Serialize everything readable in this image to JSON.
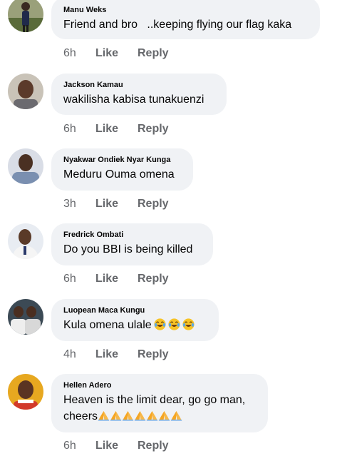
{
  "comments": [
    {
      "author": "Manu Weks",
      "text": "Friend and bro   ..keeping flying our flag kaka",
      "time": "6h",
      "like": "Like",
      "reply": "Reply"
    },
    {
      "author": "Jackson Kamau",
      "text": "wakilisha kabisa tunakuenzi",
      "time": "6h",
      "like": "Like",
      "reply": "Reply"
    },
    {
      "author": "Nyakwar Ondiek Nyar Kunga",
      "text": "Meduru Ouma omena",
      "time": "3h",
      "like": "Like",
      "reply": "Reply"
    },
    {
      "author": "Fredrick Ombati",
      "text": "Do you BBI is being killed",
      "time": "6h",
      "like": "Like",
      "reply": "Reply"
    },
    {
      "author": "Luopean Maca Kungu",
      "text": "Kula omena ulale",
      "emoji": [
        "😂",
        "😂",
        "😂"
      ],
      "time": "4h",
      "like": "Like",
      "reply": "Reply"
    },
    {
      "author": "Hellen Adero",
      "text_line1": "Heaven is the limit dear, go go man,",
      "text_line2": "cheers",
      "emoji": [
        "🙏",
        "🙏",
        "🙏",
        "🙏",
        "🙏",
        "🙏",
        "🙏"
      ],
      "time": "6h",
      "like": "Like",
      "reply": "Reply"
    }
  ],
  "colors": {
    "bubble": "#f0f2f5",
    "meta": "#65676b",
    "text": "#050505"
  }
}
